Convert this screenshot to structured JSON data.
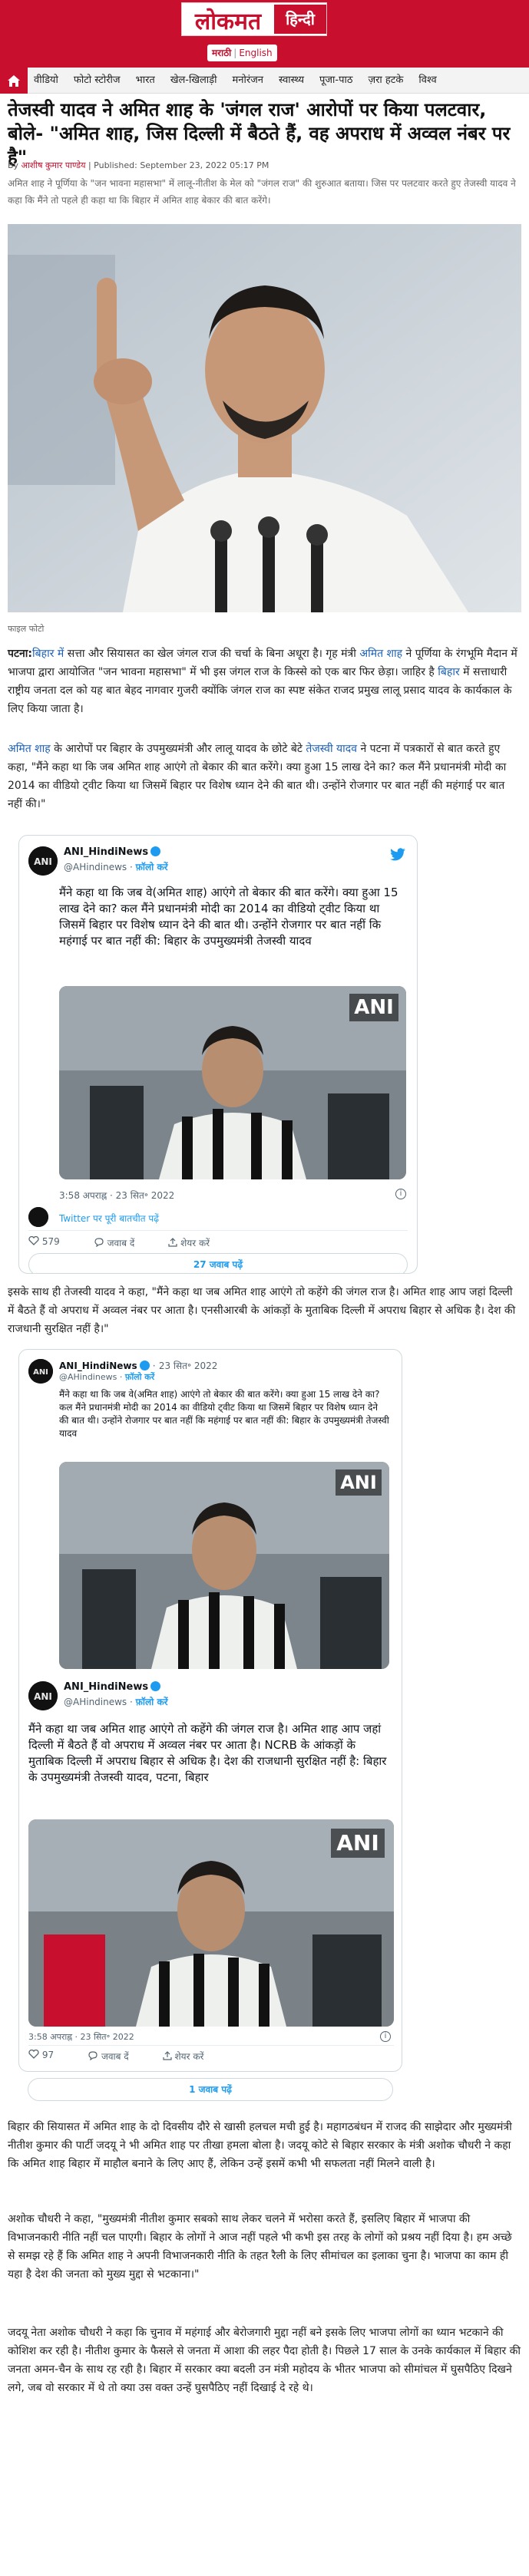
{
  "header": {
    "logo": "लोकमत",
    "logo_hindi": "हिन्दी",
    "lang_marathi": "मराठी",
    "lang_sep": "|",
    "lang_english": "English"
  },
  "nav": {
    "items": [
      "वीडियो",
      "फोटो स्टोरीज",
      "भारत",
      "खेल-खिलाड़ी",
      "मनोरंजन",
      "स्वास्थ्य",
      "पूजा-पाठ",
      "ज़रा हटके",
      "विश्व"
    ]
  },
  "article": {
    "headline": "तेजस्वी यादव ने अमित शाह के 'जंगल राज' आरोपों पर किया पलटवार, बोले- \"अमित शाह, जिस दिल्ली में बैठते हैं, वह अपराध में अव्वल नंबर पर है\"",
    "byline_prefix": "By",
    "author": "आशीष कुमार पाण्डेय",
    "published": "| Published: September 23, 2022 05:17 PM",
    "summary": "अमित शाह ने पूर्णिया के \"जन भावना महासभा\" में लालू-नीतीश के मेल को \"जंगल राज\" की शुरुआत बताया। जिस पर पलटवार करते हुए तेजस्वी यादव ने कहा कि मैंने तो पहले ही कहा था कि बिहार में अमित शाह बेकार की बात करेंगे।",
    "photo_caption": "फाइल फोटो",
    "p1_lead": "पटना:",
    "p1_link1": "बिहार में",
    "p1_a": " सत्ता और सियासत का खेल जंगल राज की चर्चा के बिना अधूरा है। गृह मंत्री ",
    "p1_link2": "अमित शाह",
    "p1_b": " ने पूर्णिया के रंगभूमि मैदान में भाजपा द्वारा आयोजित \"जन भावना महासभा\" में भी इस जंगल राज के किस्से को एक बार फिर छेड़ा। जाहिर है ",
    "p1_link3": "बिहार",
    "p1_c": " में सत्ताधारी राष्ट्रीय जनता दल को यह बात बेहद नागवार गुजरी क्योंकि जंगल राज का स्पष्ट संकेत राजद प्रमुख लालू प्रसाद यादव के कार्यकाल के लिए किया जाता है।",
    "p2_link1": "अमित शाह",
    "p2_a": " के आरोपों पर बिहार के उपमुख्यमंत्री और लालू यादव के छोटे बेटे ",
    "p2_link2": "तेजस्वी यादव",
    "p2_b": " ने पटना में पत्रकारों से बात करते हुए कहा, \"मैंने कहा था कि जब अमित शाह आएंगे तो बेकार की बात करेंगे। क्या हुआ 15 लाख देने का? कल मैंने प्रधानमंत्री मोदी का 2014 का वीडियो ट्वीट किया था जिसमें बिहार पर विशेष ध्यान देने की बात थी। उन्होंने रोजगार पर बात नहीं की महंगाई पर बात नहीं की।\"",
    "p3": "इसके साथ ही तेजस्वी यादव ने कहा, \"मैंने कहा था जब अमित शाह आएंगे तो कहेंगे की जंगल राज है। अमित शाह आप जहां दिल्ली में बैठते हैं वो अपराध में अव्वल नंबर पर आता है। एनसीआरबी के आंकड़ों के मुताबिक दिल्ली में अपराध बिहार से अधिक है। देश की राजधानी सुरक्षित नहीं है।\"",
    "p4": "बिहार की सियासत में अमित शाह के दो दिवसीय दौरे से खासी हलचल मची हुई है। महागठबंधन में राजद की साझेदार और मुख्यमंत्री नीतीश कुमार की पार्टी जदयू ने भी अमित शाह पर तीखा हमला बोला है। जदयू कोटे से बिहार सरकार के मंत्री अशोक चौधरी ने कहा कि अमित शाह बिहार में माहौल बनाने के लिए आए हैं, लेकिन उन्हें इसमें कभी भी सफलता नहीं मिलने वाली है।",
    "p5": "अशोक चौधरी ने कहा, \"मुख्यमंत्री नीतीश कुमार सबको साथ लेकर चलने में भरोसा करते हैं, इसलिए बिहार में भाजपा की विभाजनकारी नीति नहीं चल पाएगी। बिहार के लोगों ने आज नहीं पहले भी कभी इस तरह के लोगों को प्रश्रय नहीं दिया है। हम अच्छे से समझ रहे हैं कि अमित शाह ने अपनी विभाजनकारी नीति के तहत रैली के लिए सीमांचल का इलाका चुना है। भाजपा का काम ही यहा है देश की जनता को मुख्य मुद्दा से भटकाना।\"",
    "p6": "जदयू नेता अशोक चौधरी ने कहा कि चुनाव में महंगाई और बेरोजगारी मुद्दा नहीं बने इसके लिए भाजपा लोगों का ध्यान भटकाने की कोशिश कर रही है। नीतीश कुमार के फैसले से जनता में आशा की लहर पैदा होती है। पिछले 17 साल के उनके कार्यकाल में बिहार की जनता अमन-चैन के साथ रह रही है। बिहार में सरकार क्या बदली उन मंत्री महोदय के भीतर भाजपा को सीमांचल में घुसपैठिए दिखने लगे, जब वो सरकार में थे तो क्या उस वक्त उन्हें घुसपैठिए नहीं दिखाई दे रहे थे।"
  },
  "tweet1": {
    "name": "ANI_HindiNews",
    "handle": "@AHindinews",
    "dot": "·",
    "follow": "फ़ॉलो करें",
    "text": "मैंने कहा था कि जब वे(अमित शाह) आएंगे तो बेकार की बात करेंगे। क्या हुआ 15 लाख देने का? कल मैंने प्रधानमंत्री मोदी का 2014 का वीडियो ट्वीट किया था जिसमें बिहार पर विशेष ध्यान देने की बात थी। उन्होंने रोजगार पर बात नहीं कि महंगाई पर बात नहीं की: बिहार के उपमुख्यमंत्री तेजस्वी यादव",
    "ani": "ANI",
    "time": "3:58 अपराह्न · 23 सित॰ 2022",
    "info": "i",
    "twitter_link": "Twitter पर पूरी बातचीत पढ़ें",
    "likes": "579",
    "reply": "जवाब दें",
    "share": "शेयर करें",
    "replies_btn": "27 जवाब पढ़ें"
  },
  "tweet2": {
    "name": "ANI_HindiNews",
    "handle": "@AHindinews",
    "dot": "·",
    "date": "23 सित॰ 2022",
    "follow": "फ़ॉलो करें",
    "quote_text": "मैंने कहा था कि जब वे(अमित शाह) आएंगे तो बेकार की बात करेंगे। क्या हुआ 15 लाख देने का? कल मैंने प्रधानमंत्री मोदी का 2014 का वीडियो ट्वीट किया था जिसमें बिहार पर विशेष ध्यान देने की बात थी। उन्होंने रोजगार पर बात नहीं कि महंगाई पर बात नहीं की: बिहार के उपमुख्यमंत्री तेजस्वी यादव",
    "text": "मैंने कहा था जब अमित शाह आएंगे तो कहेंगे की जंगल राज है। अमित शाह आप जहां दिल्ली में बैठते हैं वो अपराध में अव्वल नंबर पर आता है। NCRB के आंकड़ों के मुताबिक दिल्ली में अपराध बिहार से अधिक है। देश की राजधानी सुरक्षित नहीं है: बिहार के उपमुख्यमंत्री तेजस्वी यादव, पटना, बिहार",
    "ani": "ANI",
    "time": "3:58 अपराह्न · 23 सित॰ 2022",
    "info": "i",
    "likes": "97",
    "reply": "जवाब दें",
    "share": "शेयर करें",
    "replies_btn": "1 जवाब पढ़ें"
  }
}
